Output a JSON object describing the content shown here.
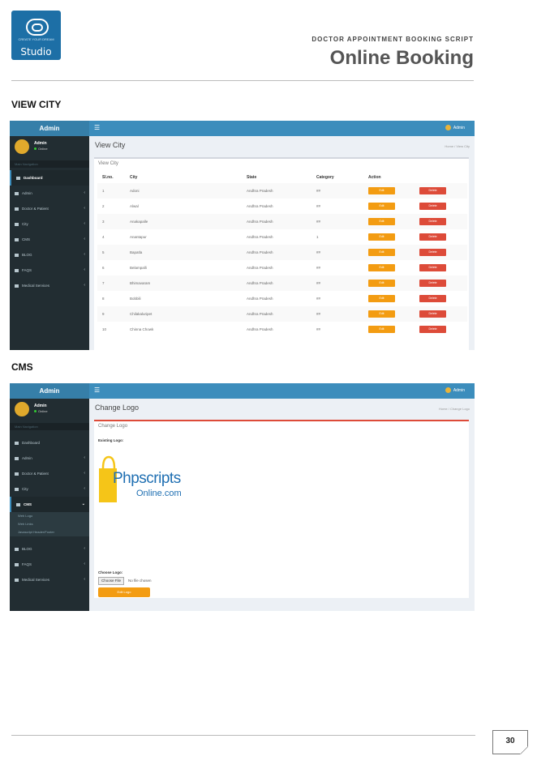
{
  "header": {
    "logo_small_text": "CREATE YOUR DREAM",
    "logo_text": "Studio",
    "subtitle": "DOCTOR APPOINTMENT BOOKING SCRIPT",
    "title": "Online Booking"
  },
  "sections": {
    "view_city": "VIEW CITY",
    "cms": "CMS"
  },
  "admin_panel": {
    "brand": "Admin",
    "menu_icon": "☰",
    "top_user": "Admin",
    "user_name": "Admin",
    "user_status": "Online",
    "nav_header": "Main Navigation",
    "menu": [
      "Dashboard",
      "Admin",
      "Doctor & Patient",
      "City",
      "CMS",
      "BLOG",
      "FAQS",
      "Medical Services"
    ],
    "cms_sub": [
      "Web Logo",
      "Web Links",
      "Javascript Header/Footer"
    ]
  },
  "view_city": {
    "page_title": "View City",
    "breadcrumb": "Home  /  View City",
    "box_title": "View City",
    "columns": [
      "Sl.no.",
      "City",
      "State",
      "Category",
      "Action"
    ],
    "edit_label": "Edit",
    "delete_label": "Delete",
    "rows": [
      [
        "1",
        "Adoni",
        "Andhra Pradesh",
        "##"
      ],
      [
        "2",
        "Alwal",
        "Andhra Pradesh",
        "##"
      ],
      [
        "3",
        "Anakapalle",
        "Andhra Pradesh",
        "##"
      ],
      [
        "4",
        "Anantapur",
        "Andhra Pradesh",
        "1"
      ],
      [
        "5",
        "Bapatla",
        "Andhra Pradesh",
        "##"
      ],
      [
        "6",
        "Belampalli",
        "Andhra Pradesh",
        "##"
      ],
      [
        "7",
        "Bhimavaram",
        "Andhra Pradesh",
        "##"
      ],
      [
        "8",
        "Bobbili",
        "Andhra Pradesh",
        "##"
      ],
      [
        "9",
        "Chilakaluripet",
        "Andhra Pradesh",
        "##"
      ],
      [
        "10",
        "Chinna Chowk",
        "Andhra Pradesh",
        "##"
      ]
    ]
  },
  "cms": {
    "page_title": "Change Logo",
    "breadcrumb": "Home  /  Change Logo",
    "box_title": "Change Logo",
    "existing_logo_label": "Existing Logo:",
    "logo_word1": "Phpscripts",
    "logo_word2": "Online.com",
    "choose_logo_label": "Choose Logo:",
    "choose_file": "Choose File",
    "no_file": "No file chosen",
    "upload_label": "Edit Logo"
  },
  "page_number": "30",
  "colors": {
    "topbar": "#3c8dbc",
    "sidebar": "#222d32",
    "edit": "#f39c12",
    "delete": "#dd4b39",
    "logo_yellow": "#f5c518",
    "logo_blue": "#1f6fb2"
  }
}
